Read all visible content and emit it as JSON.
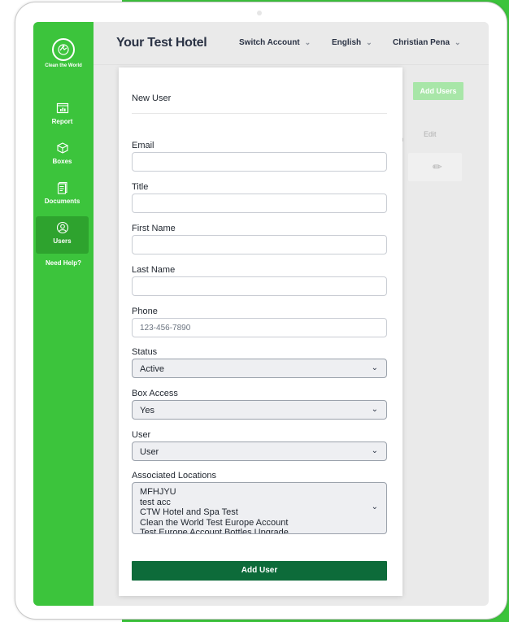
{
  "brand": {
    "logo_text": "Clean the World",
    "colors": {
      "sidebar": "#3cc43c",
      "submit": "#0d6b3a",
      "accent_light": "#a8e6a8"
    }
  },
  "sidebar": {
    "items": [
      {
        "label": "Report",
        "icon": "report-icon"
      },
      {
        "label": "Boxes",
        "icon": "box-icon"
      },
      {
        "label": "Documents",
        "icon": "documents-icon"
      },
      {
        "label": "Users",
        "icon": "user-icon",
        "active": true
      }
    ],
    "help_label": "Need Help?"
  },
  "header": {
    "hotel_name": "Your Test Hotel",
    "switch_account": "Switch Account",
    "language": "English",
    "user_name": "Christian Pena"
  },
  "background": {
    "add_users_label": "Add Users",
    "edit_column": "Edit"
  },
  "modal": {
    "title": "New User",
    "fields": {
      "email": {
        "label": "Email",
        "value": ""
      },
      "title": {
        "label": "Title",
        "value": ""
      },
      "first_name": {
        "label": "First Name",
        "value": ""
      },
      "last_name": {
        "label": "Last Name",
        "value": ""
      },
      "phone": {
        "label": "Phone",
        "value": "",
        "placeholder": "123-456-7890"
      },
      "status": {
        "label": "Status",
        "value": "Active"
      },
      "box_access": {
        "label": "Box Access",
        "value": "Yes"
      },
      "user_role": {
        "label": "User",
        "value": "User"
      },
      "locations": {
        "label": "Associated Locations",
        "options": [
          "MFHJYU",
          "test acc",
          "CTW Hotel and Spa Test",
          "Clean the World Test Europe Account",
          "Test Europe Account Bottles Upgrade"
        ]
      }
    },
    "submit_label": "Add User"
  }
}
